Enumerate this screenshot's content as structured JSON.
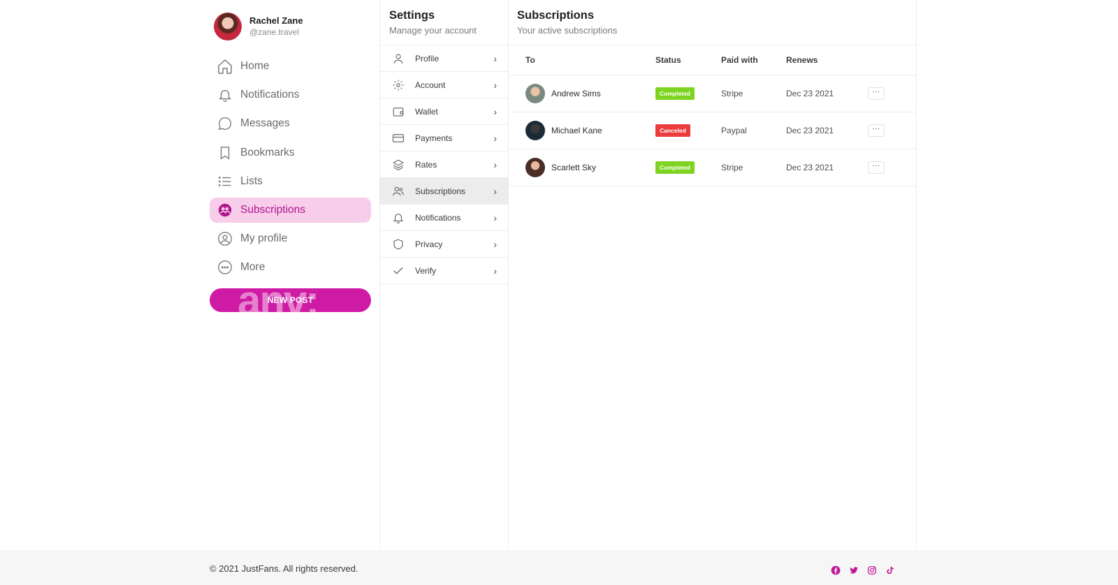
{
  "user": {
    "name": "Rachel Zane",
    "handle": "@zane.travel"
  },
  "nav": {
    "items": [
      {
        "label": "Home",
        "icon": "home-icon"
      },
      {
        "label": "Notifications",
        "icon": "bell-icon"
      },
      {
        "label": "Messages",
        "icon": "chat-bubble-icon"
      },
      {
        "label": "Bookmarks",
        "icon": "bookmark-icon"
      },
      {
        "label": "Lists",
        "icon": "list-icon"
      },
      {
        "label": "Subscriptions",
        "icon": "subscriptions-icon",
        "active": true
      },
      {
        "label": "My profile",
        "icon": "user-circle-icon"
      },
      {
        "label": "More",
        "icon": "more-circle-icon"
      }
    ],
    "new_post_label": "NEW POST"
  },
  "settings": {
    "title": "Settings",
    "subtitle": "Manage your account",
    "items": [
      {
        "label": "Profile",
        "icon": "user-icon"
      },
      {
        "label": "Account",
        "icon": "gear-icon"
      },
      {
        "label": "Wallet",
        "icon": "wallet-icon"
      },
      {
        "label": "Payments",
        "icon": "credit-card-icon"
      },
      {
        "label": "Rates",
        "icon": "layers-icon"
      },
      {
        "label": "Subscriptions",
        "icon": "users-icon",
        "active": true
      },
      {
        "label": "Notifications",
        "icon": "bell-icon"
      },
      {
        "label": "Privacy",
        "icon": "shield-icon"
      },
      {
        "label": "Verify",
        "icon": "check-icon"
      }
    ]
  },
  "subscriptions": {
    "title": "Subscriptions",
    "subtitle": "Your active subscriptions",
    "columns": {
      "to": "To",
      "status": "Status",
      "paid_with": "Paid with",
      "renews": "Renews"
    },
    "rows": [
      {
        "name": "Andrew Sims",
        "status": "Completed",
        "status_color": "#7ed321",
        "paid_with": "Stripe",
        "renews": "Dec 23 2021",
        "actions": "···"
      },
      {
        "name": "Michael Kane",
        "status": "Canceled",
        "status_color": "#ec3b3b",
        "paid_with": "Paypal",
        "renews": "Dec 23 2021",
        "actions": "···"
      },
      {
        "name": "Scarlett Sky",
        "status": "Completed",
        "status_color": "#7ed321",
        "paid_with": "Stripe",
        "renews": "Dec 23 2021",
        "actions": "···"
      }
    ]
  },
  "footer": {
    "copyright": "© 2021 JustFans. All rights reserved.",
    "socials": [
      "facebook-icon",
      "twitter-icon",
      "instagram-icon",
      "tiktok-icon"
    ]
  },
  "colors": {
    "accent": "#cf1aa5",
    "accent_light": "#f7cdea",
    "success": "#7ed321",
    "danger": "#ec3b3b"
  }
}
